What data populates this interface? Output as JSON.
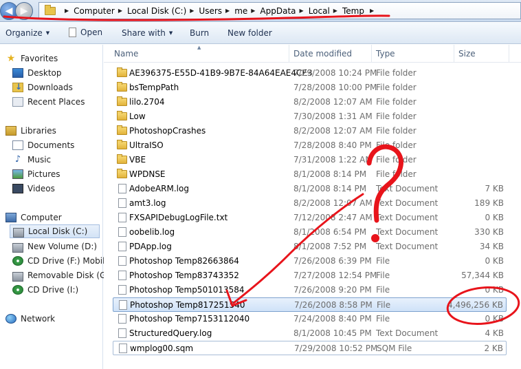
{
  "address_bar": {
    "crumbs": [
      "Computer",
      "Local Disk (C:)",
      "Users",
      "me",
      "AppData",
      "Local",
      "Temp"
    ]
  },
  "toolbar": {
    "organize": "Organize",
    "open": "Open",
    "share_with": "Share with",
    "burn": "Burn",
    "new_folder": "New folder"
  },
  "nav": {
    "favorites": "Favorites",
    "desktop": "Desktop",
    "downloads": "Downloads",
    "recent_places": "Recent Places",
    "libraries": "Libraries",
    "documents": "Documents",
    "music": "Music",
    "pictures": "Pictures",
    "videos": "Videos",
    "computer": "Computer",
    "local_disk": "Local Disk (C:)",
    "new_volume": "New Volume (D:)",
    "cd_drive_f": "CD Drive (F:) Mobile",
    "removable": "Removable Disk (G:)",
    "cd_drive_i": "CD Drive (I:)",
    "network": "Network"
  },
  "columns": {
    "name": "Name",
    "date": "Date modified",
    "type": "Type",
    "size": "Size"
  },
  "files": [
    {
      "name": "AE396375-E55D-41B9-9B7E-84A64EAE4CE3",
      "date": "7/29/2008 10:24 PM",
      "type": "File folder",
      "size": "",
      "icon": "folder-icon"
    },
    {
      "name": "bsTempPath",
      "date": "7/28/2008 10:00 PM",
      "type": "File folder",
      "size": "",
      "icon": "folder-icon"
    },
    {
      "name": "lilo.2704",
      "date": "8/2/2008 12:07 AM",
      "type": "File folder",
      "size": "",
      "icon": "folder-icon"
    },
    {
      "name": "Low",
      "date": "7/30/2008 1:31 AM",
      "type": "File folder",
      "size": "",
      "icon": "folder-icon"
    },
    {
      "name": "PhotoshopCrashes",
      "date": "8/2/2008 12:07 AM",
      "type": "File folder",
      "size": "",
      "icon": "folder-icon"
    },
    {
      "name": "UltraISO",
      "date": "7/28/2008 8:40 PM",
      "type": "File folder",
      "size": "",
      "icon": "folder-icon"
    },
    {
      "name": "VBE",
      "date": "7/31/2008 1:22 AM",
      "type": "File folder",
      "size": "",
      "icon": "folder-icon"
    },
    {
      "name": "WPDNSE",
      "date": "8/1/2008 8:14 PM",
      "type": "File folder",
      "size": "",
      "icon": "folder-icon"
    },
    {
      "name": "AdobeARM.log",
      "date": "8/1/2008 8:14 PM",
      "type": "Text Document",
      "size": "7 KB",
      "icon": "file-icon"
    },
    {
      "name": "amt3.log",
      "date": "8/2/2008 12:07 AM",
      "type": "Text Document",
      "size": "189 KB",
      "icon": "file-icon"
    },
    {
      "name": "FXSAPIDebugLogFile.txt",
      "date": "7/12/2008 2:47 AM",
      "type": "Text Document",
      "size": "0 KB",
      "icon": "file-icon"
    },
    {
      "name": "oobelib.log",
      "date": "8/1/2008 6:54 PM",
      "type": "Text Document",
      "size": "330 KB",
      "icon": "file-icon"
    },
    {
      "name": "PDApp.log",
      "date": "8/1/2008 7:52 PM",
      "type": "Text Document",
      "size": "34 KB",
      "icon": "file-icon"
    },
    {
      "name": "Photoshop Temp82663864",
      "date": "7/26/2008 6:39 PM",
      "type": "File",
      "size": "0 KB",
      "icon": "file-icon"
    },
    {
      "name": "Photoshop Temp83743352",
      "date": "7/27/2008 12:54 PM",
      "type": "File",
      "size": "57,344 KB",
      "icon": "file-icon"
    },
    {
      "name": "Photoshop Temp501013584",
      "date": "7/26/2008 9:20 PM",
      "type": "File",
      "size": "0 KB",
      "icon": "file-icon"
    },
    {
      "name": "Photoshop Temp817251540",
      "date": "7/26/2008 8:58 PM",
      "type": "File",
      "size": "4,496,256 KB",
      "icon": "file-icon"
    },
    {
      "name": "Photoshop Temp7153112040",
      "date": "7/24/2008 8:40 PM",
      "type": "File",
      "size": "0 KB",
      "icon": "file-icon"
    },
    {
      "name": "StructuredQuery.log",
      "date": "8/1/2008 10:45 PM",
      "type": "Text Document",
      "size": "4 KB",
      "icon": "file-icon"
    },
    {
      "name": "wmplog00.sqm",
      "date": "7/29/2008 10:52 PM",
      "type": "SQM File",
      "size": "2 KB",
      "icon": "file-icon"
    }
  ],
  "annotation": {
    "question_mark": "?",
    "color": "#e8141b"
  }
}
